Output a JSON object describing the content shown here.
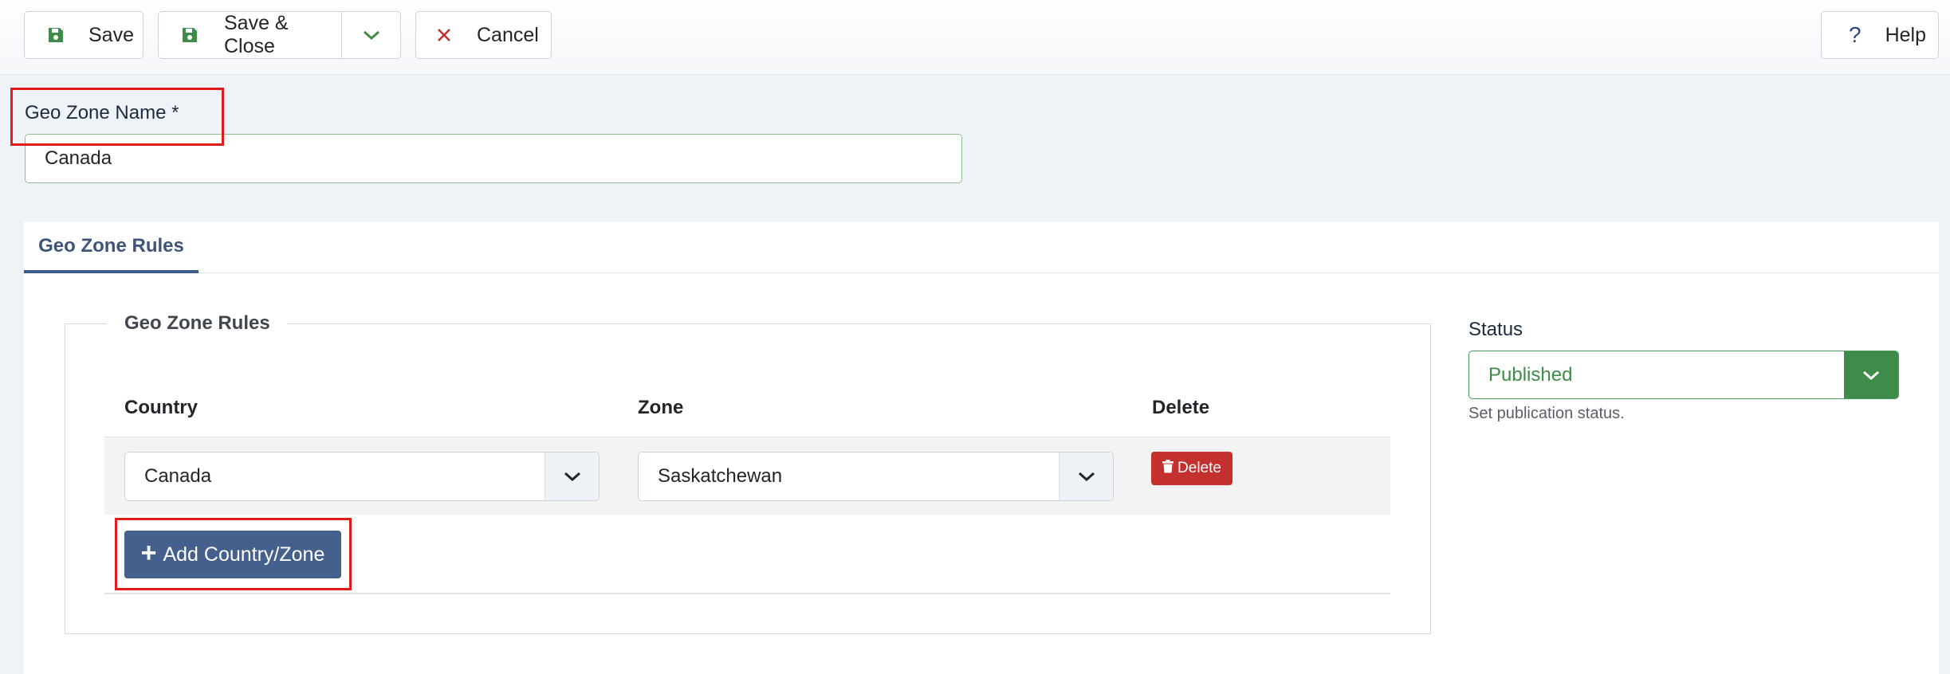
{
  "toolbar": {
    "save_label": "Save",
    "save_close_label": "Save & Close",
    "cancel_label": "Cancel",
    "help_label": "Help",
    "help_icon_glyph": "?"
  },
  "form": {
    "geo_zone_name_label": "Geo Zone Name *",
    "geo_zone_name_value": "Canada"
  },
  "tabs": [
    {
      "label": "Geo Zone Rules",
      "active": true
    }
  ],
  "rules": {
    "legend": "Geo Zone Rules",
    "columns": [
      "Country",
      "Zone",
      "Delete"
    ],
    "rows": [
      {
        "country": "Canada",
        "zone": "Saskatchewan",
        "delete_label": "Delete"
      }
    ],
    "add_label": "Add Country/Zone"
  },
  "status": {
    "label": "Status",
    "value": "Published",
    "help": "Set publication status."
  },
  "colors": {
    "primary": "#45608c",
    "danger": "#c3302e",
    "success": "#3f8b49",
    "highlight": "#e01b1b"
  },
  "icons": {
    "save": "floppy-disk-icon",
    "dropdown": "chevron-down-icon",
    "cancel": "close-icon",
    "help": "question-icon",
    "delete": "trash-icon",
    "add": "plus-icon"
  }
}
